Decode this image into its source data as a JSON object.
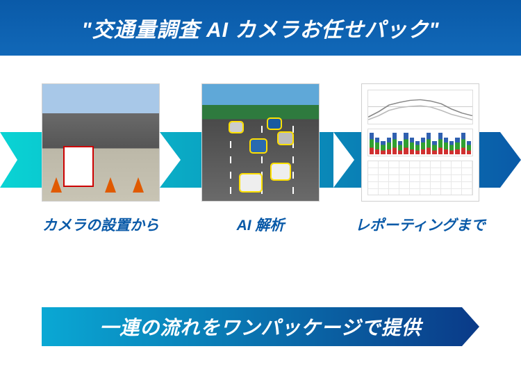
{
  "title": "\"交通量調査 AI カメラお任せパック\"",
  "steps": [
    {
      "label": "カメラの設置から",
      "icon": "camera-install-photo"
    },
    {
      "label": "AI 解析",
      "icon": "ai-analysis-photo"
    },
    {
      "label": "レポーティングまで",
      "icon": "report-dashboard-photo"
    }
  ],
  "bottom_tagline": "一連の流れをワンパッケージで提供",
  "colors": {
    "primary": "#0a5aa8",
    "arrow_gradient_start": "#0ad4d4",
    "arrow_gradient_end": "#0a5aa8"
  }
}
